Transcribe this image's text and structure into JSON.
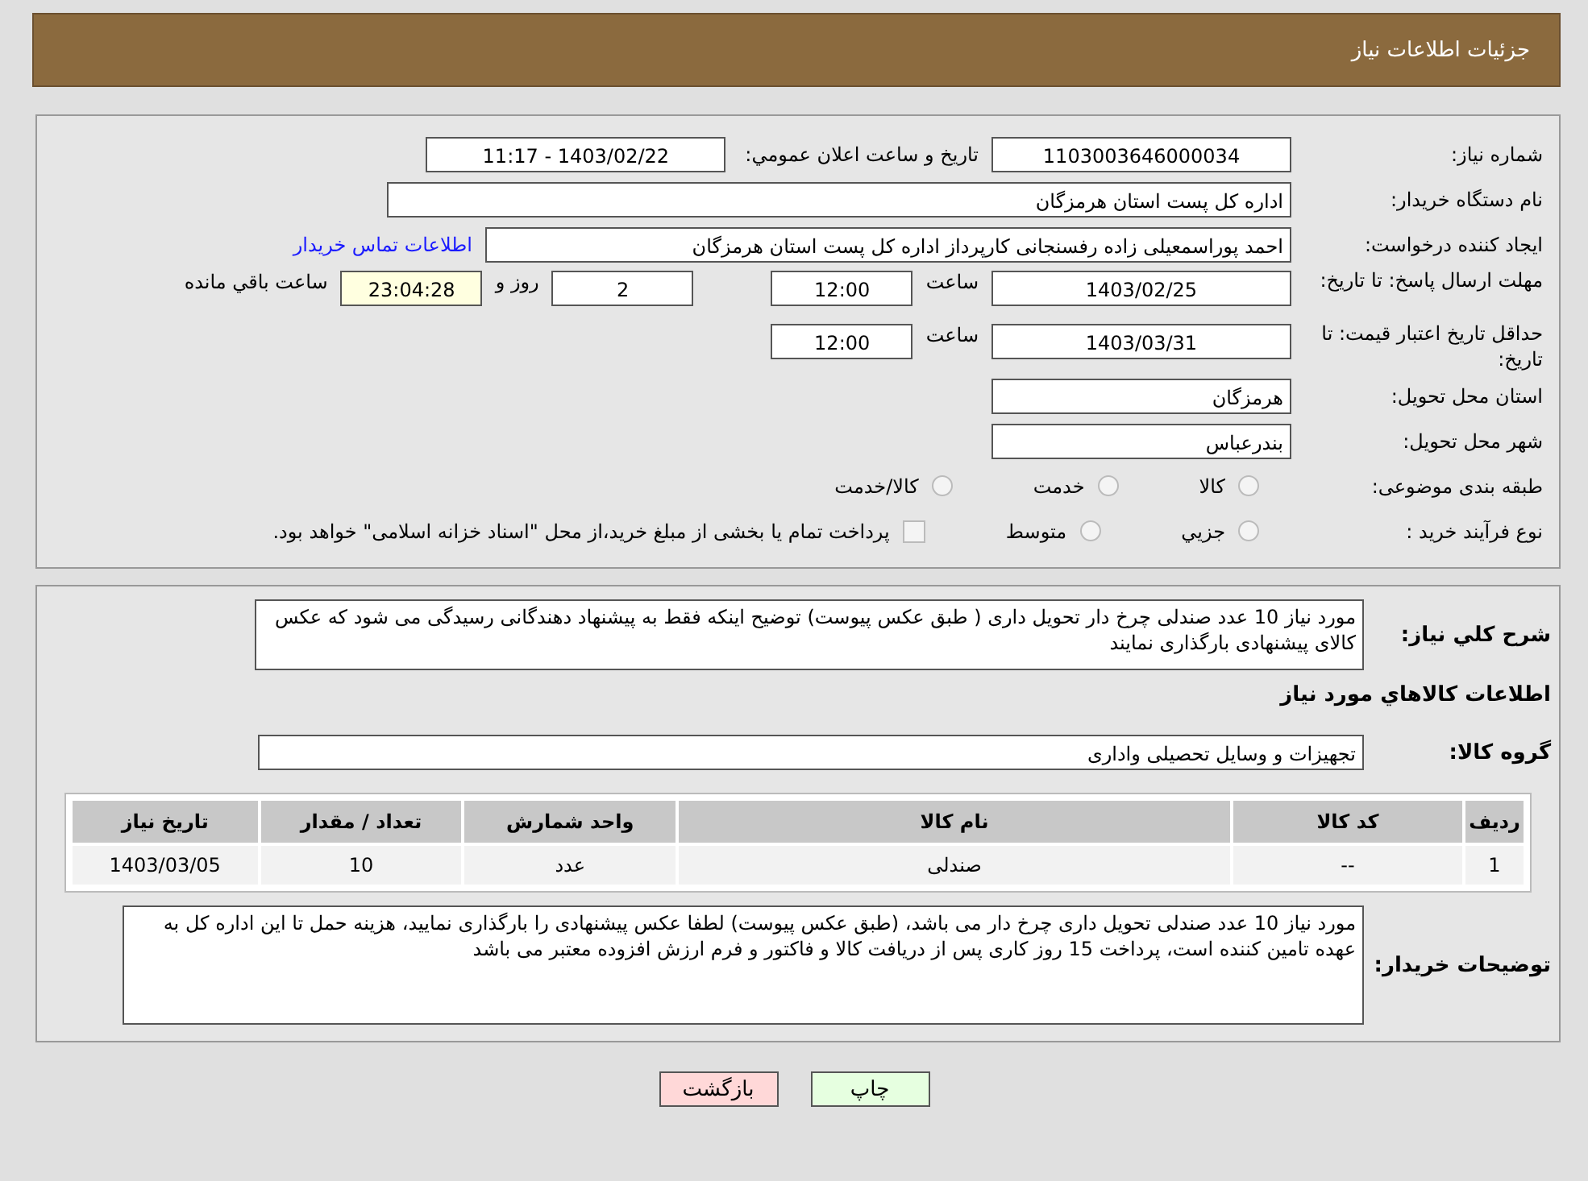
{
  "header": {
    "title": "جزئیات اطلاعات نیاز"
  },
  "need_number": {
    "label": "شماره نیاز:",
    "value": "1103003646000034"
  },
  "announce": {
    "label": "تاریخ و ساعت اعلان عمومي:",
    "value": "1403/02/22 - 11:17"
  },
  "buyer_org": {
    "label": "نام دستگاه خريدار:",
    "value": "اداره کل پست استان هرمزگان"
  },
  "requester": {
    "label": "ایجاد کننده درخواست:",
    "value": "احمد پوراسمعیلی زاده رفسنجانی کارپرداز اداره کل پست استان هرمزگان",
    "link": "اطلاعات تماس خریدار"
  },
  "reply_deadline": {
    "label": "مهلت ارسال پاسخ: تا تاریخ:",
    "date": "1403/02/25",
    "time_label": "ساعت",
    "time": "12:00",
    "days": "2",
    "days_label": "روز و",
    "remaining": "23:04:28",
    "remaining_label": "ساعت باقي مانده"
  },
  "price_validity": {
    "label": "حداقل تاریخ اعتبار قیمت: تا تاریخ:",
    "date": "1403/03/31",
    "time_label": "ساعت",
    "time": "12:00"
  },
  "province": {
    "label": "استان محل تحویل:",
    "value": "هرمزگان"
  },
  "city": {
    "label": "شهر محل تحویل:",
    "value": "بندرعباس"
  },
  "category": {
    "label": "طبقه بندی موضوعی:",
    "options": [
      {
        "kind": "radio",
        "label": "کالا",
        "selected": false
      },
      {
        "kind": "radio",
        "label": "خدمت",
        "selected": false
      },
      {
        "kind": "radio",
        "label": "کالا/خدمت",
        "selected": false
      }
    ]
  },
  "purchase_type": {
    "label": "نوع فرآیند خرید :",
    "options": [
      {
        "kind": "radio",
        "label": "جزیي",
        "selected": false
      },
      {
        "kind": "radio",
        "label": "متوسط",
        "selected": false
      },
      {
        "kind": "checkbox",
        "label": "پرداخت تمام یا بخشی از مبلغ خرید،از محل \"اسناد خزانه اسلامی\" خواهد بود.",
        "selected": false
      }
    ]
  },
  "summary": {
    "label": "شرح کلي نياز:",
    "value": "مورد نیاز 10 عدد صندلی چرخ دار تحویل داری ( طبق عکس پیوست) توضیح اینکه فقط به پیشنهاد دهندگانی رسیدگی می شود که عکس کالای پیشنهادی بارگذاری نمایند"
  },
  "items_title": "اطلاعات کالاهاي مورد نياز",
  "goods_group": {
    "label": "گروه کالا:",
    "value": "تجهیزات و وسایل تحصیلی واداری"
  },
  "table": {
    "columns": [
      "رديف",
      "کد کالا",
      "نام کالا",
      "واحد شمارش",
      "تعداد / مقدار",
      "تاریخ نیاز"
    ],
    "rows": [
      [
        "1",
        "--",
        "صندلی",
        "عدد",
        "10",
        "1403/03/05"
      ]
    ]
  },
  "buyer_notes": {
    "label": "توضیحات خریدار:",
    "value": "مورد نیاز 10 عدد صندلی تحویل داری چرخ دار می باشد، (طبق عکس پیوست) لطفا عکس پیشنهادی را بارگذاری نمایید، هزینه حمل تا این اداره کل به عهده تامین کننده است، پرداخت 15 روز کاری پس از دریافت کالا و فاکتور  و فرم ارزش افزوده معتبر می باشد"
  },
  "buttons": [
    {
      "kind": "print",
      "label": "چاپ"
    },
    {
      "kind": "back",
      "label": "بازگشت"
    }
  ]
}
